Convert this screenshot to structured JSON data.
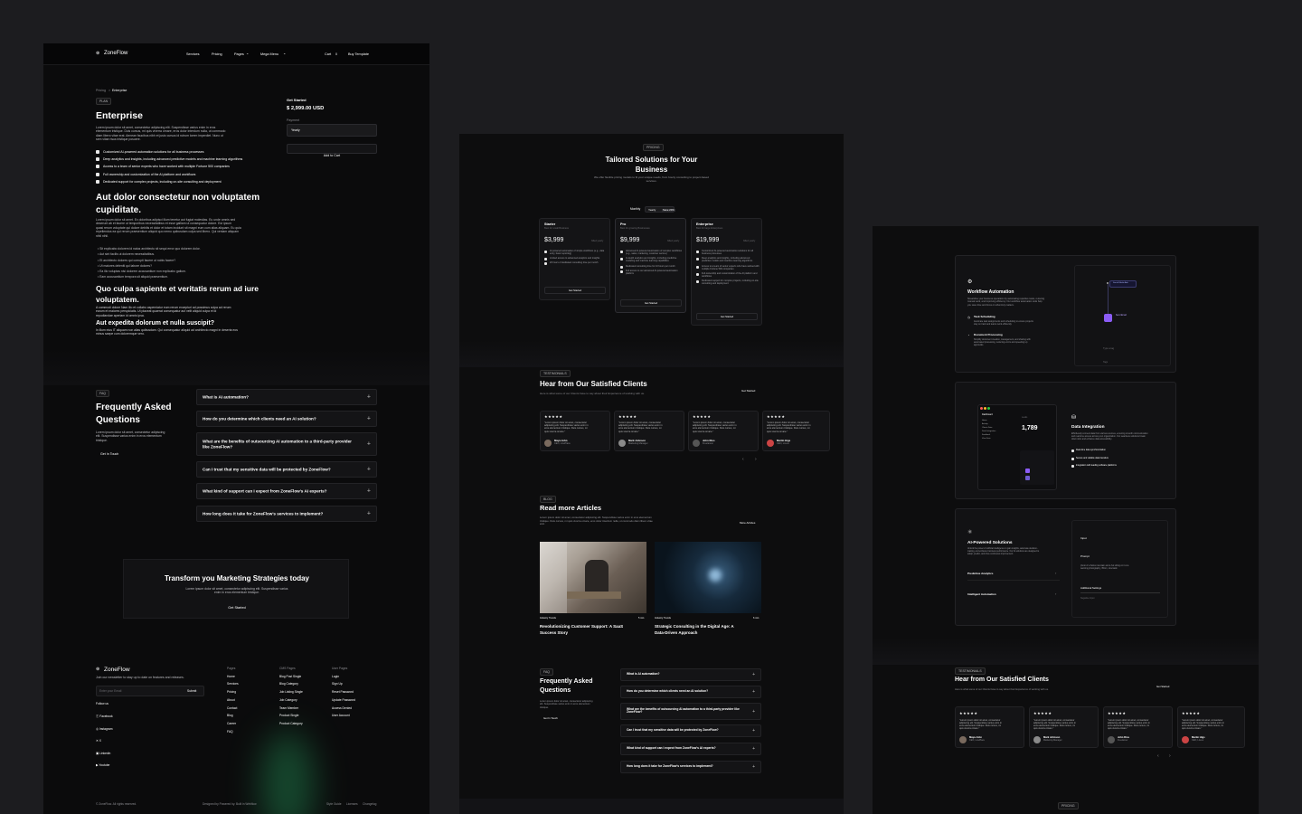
{
  "p1": {
    "nav": {
      "brand": "ZoneFlow",
      "links": [
        "Services",
        "Pricing",
        "Pages",
        "Mega Menu"
      ],
      "cart": "Cart",
      "cart_count": "0",
      "cta": "Buy Template"
    },
    "breadcrumb": {
      "a": "Pricing",
      "sep": ">",
      "b": "Enterprise"
    },
    "plan_badge": "PLAN",
    "title": "Enterprise",
    "intro": [
      "Lorem ipsum dolor sit amet, consectetur adipiscing elit. Suspendisse varius enim in eros",
      "elementum tristique. Duis cursus, mi quis viverra ornare, eros dolor interdum nulla, ut commodo",
      "diam libero vitae erat. Aenean faucibus nibh et justo cursus id rutrum lorem imperdiet. Nunc ut",
      "sem vitae risus tristique posuere."
    ],
    "features": [
      "Customized AI-powered automation solutions for all business processes",
      "Deep analytics and insights, including advanced predictive models and machine learning algorithms",
      "Access to a team of senior experts who have worked with multiple Fortune 500 companies",
      "Full ownership and customization of the AI platform and workflows",
      "Dedicated support for complex projects, including on-site consulting and deployment"
    ],
    "h2": [
      "Aut dolor consectetur non voluptatem",
      "cupiditate."
    ],
    "para2": [
      "Lorem ipsum dolor sit amet. Ex doloribus adipisci illum tenetur aut fugiat molestias. Eu unde omnis sed",
      "deserunt ab et facere ut temporibus necessitatibus et esse galliam ut consequatur dolore. Est ipsum",
      "quasi rerum voluptate qui dolore debitis et dolor et totam incidunt sit magni eum cum alias aliquam. Eu quia",
      "repellendus ea qui rerum praesentium aliquid quo nemo quibusdam culpa sed libero. Qui veniam aliquam",
      "nihil nihil."
    ],
    "bullets": [
      "Sit explicabo dolorem id natus architecto sit sequi error quo dolorem dolor.",
      "Aut sint facilis ut dolorem necessitatibus.",
      "Et architecto dolores qui corrupti facere ut nobis facere?",
      "Ut maiores deleniti qui labore dolores?",
      "Ea illo voluptas nisi dolorem accusantium non explicabo galium.",
      "Eam accusantium tempora sit aliquid praesentium."
    ],
    "h3": [
      "Quo culpa sapiente et veritatis rerum ad iure",
      "voluptatem."
    ],
    "para3": [
      "A commodi dolore Nam illo et collatro asperniatur eum rerum excepturi ad possimus culpa ad rerum",
      "earum et maiores perspiciatis. Ut placeat quaerat consequatur aut velit aliquid culpa et id",
      "repudiandae aperiam id omnis ipsa."
    ],
    "h4": "Aut expedita dolorum et nulla suscipit?",
    "para4": [
      "In illum eius IT aliquam non alias quibusdam. Qui consequatur aliquid ad architecto magni in deserta eos",
      "minus saepe cum doloremque vero."
    ],
    "side": {
      "label": "Get Started",
      "price": "$ 2,999.00 USD",
      "payment": "Payment",
      "select": "Yearly",
      "add": "Add to Cart"
    },
    "faq": {
      "badge": "FAQ",
      "title": [
        "Frequently Asked",
        "Questions"
      ],
      "desc": [
        "Lorem ipsum dolor sit amet, consectetur adipiscing",
        "elit. Suspendisse varius enim in eros elementum",
        "tristique."
      ],
      "link": "Get In Touch",
      "items": [
        "What is AI automation?",
        "How do you determine which clients need an AI solution?",
        "What are the benefits of outsourcing AI automation to a third-party provider like ZoneFlow?",
        "Can I trust that my sensitive data will be protected by ZoneFlow?",
        "What kind of support can I expect from ZoneFlow's AI experts?",
        "How long does it take for ZoneFlow's services to implement?"
      ],
      "plus": "+"
    },
    "cta": {
      "title": "Transform you Marketing Strategies today",
      "desc": [
        "Lorem ipsum dolor sit amet, consectetur adipiscing elit. Suspendisse varius",
        "enim in eros elementum tristique."
      ],
      "button": "Get Started"
    },
    "footer": {
      "brand": "ZoneFlow",
      "desc": "Join our newsletter to stay up to date on features and releases.",
      "input_ph": "Enter your Email",
      "submit": "Submit",
      "follow": "Follow us",
      "social": [
        "Facebook",
        "Instagram",
        "X",
        "Linkedin",
        "Youtube"
      ],
      "cols": [
        {
          "title": "Pages",
          "items": [
            "Home",
            "Services",
            "Pricing",
            "About",
            "Contact",
            "Blog",
            "Career",
            "FAQ"
          ]
        },
        {
          "title": "CMS Pages",
          "items": [
            "Blog Post Single",
            "Blog Category",
            "Job Listing Single",
            "Job Category",
            "Team Member",
            "Product Single",
            "Product Category"
          ]
        },
        {
          "title": "User Pages",
          "items": [
            "Login",
            "Sign Up",
            "Reset Password",
            "Update Password",
            "Access Denied",
            "User Account"
          ]
        }
      ],
      "copyright": "© ZoneFlow. All rights reserved.",
      "designed": "Designed by Powered by. Built in Webflow",
      "bottom_links": [
        "Style Guide",
        "Licenses",
        "Changelog"
      ]
    }
  },
  "p2": {
    "pricing": {
      "badge": "PRICING",
      "title": [
        "Tailored Solutions for Your",
        "Business"
      ],
      "desc": [
        "We offer flexible pricing models to fit your unique needs, from hourly consulting to project-based",
        "services."
      ],
      "toggle": {
        "monthly": "Monthly",
        "yearly": "Yearly",
        "save": "Save 20%"
      },
      "plans": [
        {
          "name": "Starter",
          "sub": "Best for small Business",
          "price": "$3,999",
          "cycle": "billed yearly",
          "features": [
            "AI-powered automation of simple workflows (e.g., data entry, basic reporting)",
            "Limited access to advanced analytics and insights",
            "20 hours of dedicated consulting time per month"
          ],
          "button": "Get Started"
        },
        {
          "name": "Pro",
          "sub": "Best for growing Businesses",
          "price": "$9,999",
          "cycle": "billed yearly",
          "features": [
            "Advanced AI-powered automation of complex workflows (e.g., sales, marketing, customer service)",
            "In-depth analytics and insights, including predictive modeling and machine learning capabilities",
            "Dedicated consulting time for 10 hours per month",
            "Full access to our advanced AI-powered automation platform"
          ],
          "button": "Get Started"
        },
        {
          "name": "Enterprise",
          "sub": "Best for large Enterprises",
          "price": "$19,999",
          "cycle": "billed yearly",
          "features": [
            "Customized AI-powered automation solutions for all business processes",
            "Deep analytics and insights, including advanced predictive models and machine learning algorithms",
            "Access to a team of senior experts who have worked with multiple Fortune 500 companies",
            "Full ownership and customization of the AI platform and workflows",
            "Dedicated support for complex projects, including on-site consulting and deployment"
          ],
          "button": "Get Started"
        }
      ]
    },
    "testimonials": {
      "badge": "TESTIMONIALS",
      "title": "Hear from Our Satisfied Clients",
      "desc": "Here is what some of our Clients have to say about their Experience of working with us.",
      "link": "Get Started",
      "items": [
        {
          "quote": [
            "\"Lorem ipsum dolor sit amet, consectetur",
            "adipiscing elit. Suspendisse varius enim in",
            "eros elementum tristique. Duis cursus, mi",
            "quis viverra ornare.\""
          ],
          "name": "Maya John",
          "role": "CEO, LinePlace"
        },
        {
          "quote": [
            "\"Lorem ipsum dolor sit amet, consectetur",
            "adipiscing elit. Suspendisse varius enim in",
            "eros elementum tristique. Duis cursus, mi",
            "quis viverra ornare.\""
          ],
          "name": "Mark Johnson",
          "role": "Marketing Manager"
        },
        {
          "quote": [
            "\"Lorem ipsum dolor sit amet, consectetur",
            "adipiscing elit. Suspendisse varius enim in",
            "eros elementum tristique. Duis cursus, mi",
            "quis viverra ornare.\""
          ],
          "name": "John Rios",
          "role": "Freelancer"
        },
        {
          "quote": [
            "\"Lorem ipsum dolor sit amet, consectetur",
            "adipiscing elit. Suspendisse varius enim in",
            "eros elementum tristique. Duis cursus, mi",
            "quis viverra ornare.\""
          ],
          "name": "Martin Higs",
          "role": "CEO, Lireus"
        }
      ],
      "stars": "★★★★★"
    },
    "blog": {
      "badge": "BLOG",
      "title": "Read more Articles",
      "desc": [
        "Lorem ipsum dolor sit amet, consectetur adipiscing elit. Suspendisse varius enim in eros elementum",
        "tristique. Duis cursus, mi quis viverra ornare, eros dolor interdum nulla, ut commodo diam libero vitae",
        "erat."
      ],
      "link": "More Articles",
      "posts": [
        {
          "category": "Industry Trends",
          "read": "5 min",
          "title": [
            "Revolutionizing Customer Support: A SaaS",
            "Success Story"
          ]
        },
        {
          "category": "Industry Trends",
          "read": "6 min",
          "title": [
            "Strategic Consulting in the Digital Age: A",
            "Data-Driven Approach"
          ]
        }
      ]
    },
    "faq": {
      "badge": "FAQ",
      "title": [
        "Frequently Asked",
        "Questions"
      ],
      "desc": [
        "Lorem ipsum dolor sit amet, consectetur adipiscing",
        "elit. Suspendisse varius enim in eros elementum",
        "tristique."
      ],
      "link": "Get In Touch",
      "items": [
        "What is AI automation?",
        "How do you determine which clients need an AI solution?",
        "What are the benefits of outsourcing AI automation to a third-party provider like ZoneFlow?",
        "Can I trust that my sensitive data will be protected by ZoneFlow?",
        "What kind of support can I expect from ZoneFlow's AI experts?",
        "How long does it take for ZoneFlow's services to implement?"
      ]
    }
  },
  "p3": {
    "workflow": {
      "title": "Workflow Automation",
      "desc": [
        "Streamline your business operations by automating repetitive tasks, reducing",
        "manual work, and improving efficiency. Our workflow automation tools help",
        "you save time and focus on what truly matters."
      ],
      "items": [
        {
          "title": "Task Scheduling",
          "desc": [
            "Automate task assignments and scheduling to ensure projects",
            "stay on track and teams work efficiently."
          ]
        },
        {
          "title": "Document Processing",
          "desc": [
            "Simplify document creation, management, and sharing with",
            "automated processing, reducing errors and speeding up",
            "approvals."
          ]
        }
      ],
      "node1": "Social Media Ads",
      "node2": "Send Email",
      "input_ph": "Type a tag",
      "tags": "Tags"
    },
    "data": {
      "title": "Data Integration",
      "desc": [
        "Effortlessly connect data from various sources, ensuring smooth communication",
        "and real-time access across your organization. Our seamless solutions break",
        "down silos and enhance data accessibility."
      ],
      "features": [
        "Real-time data synchronization",
        "Secure and reliable data transfers",
        "Integration with leading software platforms"
      ],
      "stat": "1,789",
      "stat_label": "Leads",
      "dash_title": "Dashboard",
      "dash_items": [
        "Home",
        "Activity",
        "Clients Data",
        "Dash Integration",
        "Feedback",
        "View Data"
      ]
    },
    "ai": {
      "title": "AI-Powered Solutions",
      "desc": [
        "Unlock the power of artificial intelligence to gain insights, automate decision-",
        "making, and enhance business performance. Our AI solutions are designed to",
        "adapt, predict, and drive continuous improvement."
      ],
      "items": [
        "Predictive Analytics",
        "Intelligent Automation"
      ],
      "form": {
        "input": "Input",
        "prompt": "Prompt",
        "prompt_text": [
          "photo of a Swiss mountain and a hut sitting on it at a",
          "warming photography, 35mm, cinematic."
        ],
        "settings": "Additional Settings",
        "negative": "Negative Input"
      }
    },
    "testimonials": {
      "badge": "TESTIMONIALS",
      "title": "Hear from Our Satisfied Clients",
      "desc": "Here is what some of our Clients have to say about their Experience of working with us.",
      "link": "Get Started",
      "items": [
        {
          "name": "Maya John",
          "role": "CEO, LinePlace"
        },
        {
          "name": "Mark Johnson",
          "role": "Marketing Manager"
        },
        {
          "name": "John Rios",
          "role": "Freelancer"
        },
        {
          "name": "Martin Higs",
          "role": "CEO, Lireus"
        }
      ],
      "quote": [
        "\"Lorem ipsum dolor sit amet, consectetur",
        "adipiscing elit. Suspendisse varius enim in",
        "eros elementum tristique. Duis cursus, mi",
        "quis viverra ornare.\""
      ],
      "stars": "★★★★★",
      "pricing_badge": "PRICING"
    }
  },
  "colors": {
    "bg": "#1c1c1f",
    "panel": "#0b0b0c",
    "card": "#141416",
    "accent_green": "#2e8b57",
    "accent_purple": "#8b5cf6"
  }
}
